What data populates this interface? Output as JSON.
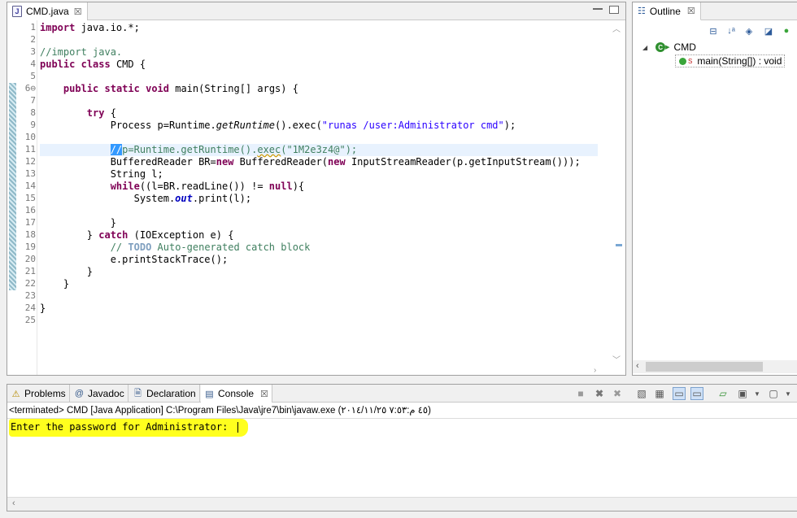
{
  "editor": {
    "tab_label": "CMD.java",
    "tab_icon": "J",
    "close_glyph": "☒",
    "lines": [
      {
        "n": "1"
      },
      {
        "n": "2"
      },
      {
        "n": "3"
      },
      {
        "n": "4"
      },
      {
        "n": "5"
      },
      {
        "n": "6⊖"
      },
      {
        "n": "7"
      },
      {
        "n": "8"
      },
      {
        "n": "9"
      },
      {
        "n": "10"
      },
      {
        "n": "11"
      },
      {
        "n": "12"
      },
      {
        "n": "13"
      },
      {
        "n": "14"
      },
      {
        "n": "15"
      },
      {
        "n": "16"
      },
      {
        "n": "17"
      },
      {
        "n": "18"
      },
      {
        "n": "19"
      },
      {
        "n": "20"
      },
      {
        "n": "21"
      },
      {
        "n": "22"
      },
      {
        "n": "23"
      },
      {
        "n": "24"
      },
      {
        "n": "25"
      }
    ],
    "code": {
      "l1_kw": "import",
      "l1_rest": " java.io.*;",
      "l3": "//import java.",
      "l4_kw1": "public",
      "l4_kw2": "class",
      "l4_rest": " CMD {",
      "l6_kw1": "public",
      "l6_kw2": "static",
      "l6_kw3": "void",
      "l6_rest": " main(String[] args) {",
      "l8_kw": "try",
      "l8_rest": " {",
      "l9_a": "Process p=Runtime.",
      "l9_b": "getRuntime",
      "l9_c": "().exec(",
      "l9_str": "\"runas /user:Administrator cmd\"",
      "l9_d": ");",
      "l11_sel": "//",
      "l11_a": "p=Runtime.getRuntime().",
      "l11_b": "exec",
      "l11_c": "(\"1M2e3z4@\");",
      "l12_a": "BufferedReader BR=",
      "l12_kw1": "new",
      "l12_b": " BufferedReader(",
      "l12_kw2": "new",
      "l12_c": " InputStreamReader(p.getInputStream()));",
      "l13": "String l;",
      "l14_kw1": "while",
      "l14_a": "((l=BR.readLine()) != ",
      "l14_kw2": "null",
      "l14_b": "){",
      "l15_a": "System.",
      "l15_fld": "out",
      "l15_b": ".print(l);",
      "l17": "}",
      "l18_a": "} ",
      "l18_kw": "catch",
      "l18_b": " (IOException e) {",
      "l19_a": "// ",
      "l19_todo": "TODO",
      "l19_b": " Auto-generated catch block",
      "l20": "e.printStackTrace();",
      "l21": "}",
      "l22": "}",
      "l24": "}"
    }
  },
  "outline": {
    "tab_label": "Outline",
    "close_glyph": "☒",
    "toolbar_icons": [
      "collapse-all-icon",
      "sort-icon",
      "hide-fields-icon",
      "hide-static-icon",
      "hide-nonpublic-icon"
    ],
    "toolbar_glyphs": [
      "⊟",
      "↓ᵃ",
      "◈",
      "◪",
      "●"
    ],
    "class_name": "CMD",
    "method_sig": "main(String[]) : void",
    "static_badge": "S"
  },
  "console": {
    "tabs": [
      {
        "label": "Problems",
        "icon": "problems-icon",
        "glyph": "⚠"
      },
      {
        "label": "Javadoc",
        "icon": "javadoc-icon",
        "glyph": "@"
      },
      {
        "label": "Declaration",
        "icon": "declaration-icon",
        "glyph": "🗎"
      },
      {
        "label": "Console",
        "icon": "console-icon",
        "glyph": "▤"
      }
    ],
    "active_tab": "Console",
    "close_glyph": "☒",
    "terminated": "<terminated> CMD [Java Application] C:\\Program Files\\Java\\jre7\\bin\\javaw.exe (۲۰۱٤/۱۱/۲٥ ۷:٥۳:٤٥ م)",
    "output": "Enter the password for Administrator:",
    "highlight_color": "#ffff1e"
  }
}
